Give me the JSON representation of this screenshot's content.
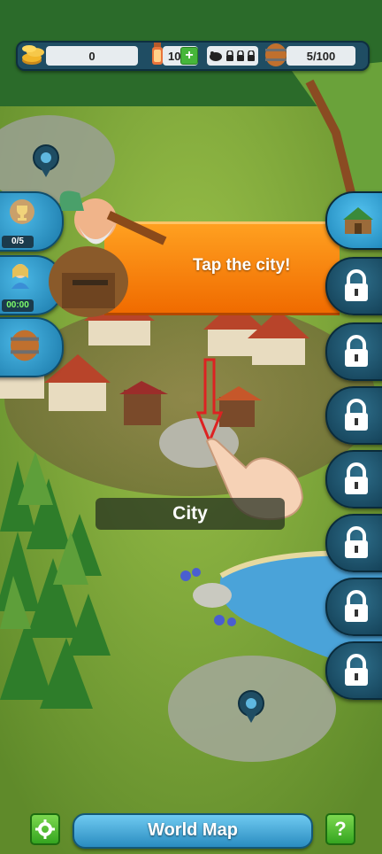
{
  "resources": {
    "gold": "0",
    "lanterns": "10",
    "barrels": "5/100",
    "add_label": "+"
  },
  "side_left": {
    "trophy_progress": "0/5",
    "quest_timer": "00:00"
  },
  "tutorial": {
    "message": "Tap the city!"
  },
  "map": {
    "city_label": "City"
  },
  "bottom": {
    "world_map_label": "World Map",
    "help_label": "?"
  },
  "colors": {
    "banner": "#f28a10",
    "button_blue": "#2a8cc0",
    "button_green": "#46b63a",
    "grass": "#7aa23a"
  },
  "icons": [
    "gold-coins-icon",
    "lantern-icon",
    "pig-icon",
    "lock-icon",
    "barrel-icon",
    "trophy-icon",
    "princess-icon",
    "arrow-down-icon",
    "hand-pointer-icon",
    "gear-icon",
    "castle-icon"
  ]
}
